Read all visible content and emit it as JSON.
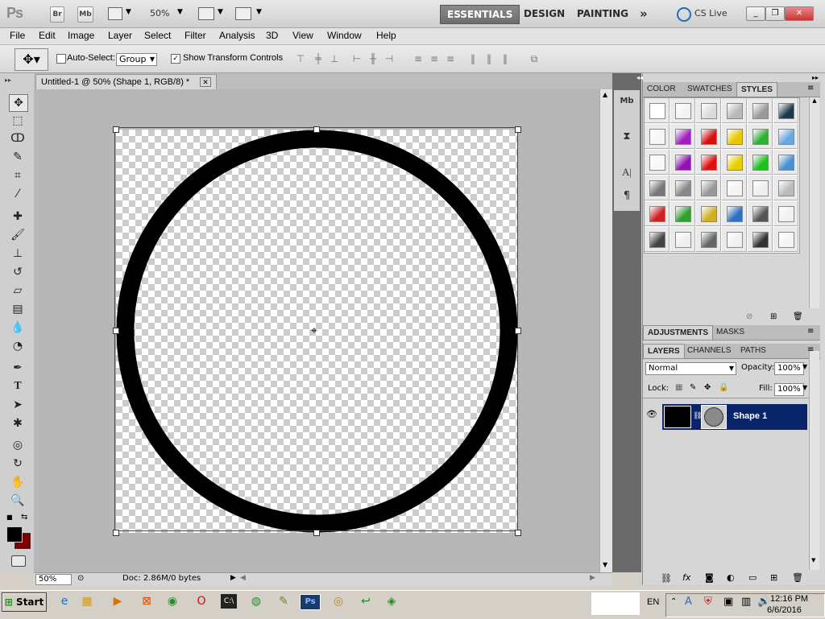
{
  "appbar": {
    "logo": "Ps",
    "bridge": "Br",
    "minibridge": "Mb",
    "zoom": "50%",
    "workspaces": [
      "ESSENTIALS",
      "DESIGN",
      "PAINTING"
    ],
    "more": "»",
    "cslive": "CS Live"
  },
  "menu": [
    "File",
    "Edit",
    "Image",
    "Layer",
    "Select",
    "Filter",
    "Analysis",
    "3D",
    "View",
    "Window",
    "Help"
  ],
  "options": {
    "auto_select_label": "Auto-Select:",
    "auto_select_value": "Group",
    "transform_label": "Show Transform Controls"
  },
  "document": {
    "tab_title": "Untitled-1 @ 50% (Shape 1, RGB/8) *",
    "zoom": "50%",
    "doc_info": "Doc: 2.86M/0 bytes"
  },
  "panels": {
    "color_tab": "COLOR",
    "swatches_tab": "SWATCHES",
    "styles_tab": "STYLES",
    "adjustments_tab": "ADJUSTMENTS",
    "masks_tab": "MASKS",
    "layers_tab": "LAYERS",
    "channels_tab": "CHANNELS",
    "paths_tab": "PATHS",
    "blend_mode": "Normal",
    "opacity_label": "Opacity:",
    "opacity_value": "100%",
    "lock_label": "Lock:",
    "fill_label": "Fill:",
    "fill_value": "100%",
    "layer_name": "Shape 1"
  },
  "styles_grid": [
    [
      "#ffffff",
      "#f2f2f2",
      "#dcdcdc",
      "#b9b9b9",
      "#9a9a9a",
      "#1e3a4a"
    ],
    [
      "#f5f5f5",
      "#a020c0",
      "#d81010",
      "#e8c800",
      "#30b030",
      "#6aa8e0"
    ],
    [
      "#f7f7f7",
      "#9010b0",
      "#e01010",
      "#e8d000",
      "#20c020",
      "#4a90d0"
    ],
    [
      "#777777",
      "#888888",
      "#999999",
      "#f4f4f4",
      "#eeeeee",
      "#bbbbbb"
    ],
    [
      "#d02020",
      "#30a030",
      "#d0b020",
      "#3070c0",
      "#555555",
      "#f0f0f0"
    ],
    [
      "#444444",
      "#eeeeee",
      "#666666",
      "#f0f0f0",
      "#333333",
      "#f4f4f4"
    ]
  ],
  "taskbar": {
    "start": "Start",
    "lang": "EN",
    "time": "12:16 PM",
    "date": "6/6/2016"
  },
  "colors": {
    "foreground": "#000000",
    "background": "#7a0000",
    "selection": "#0a246a"
  }
}
